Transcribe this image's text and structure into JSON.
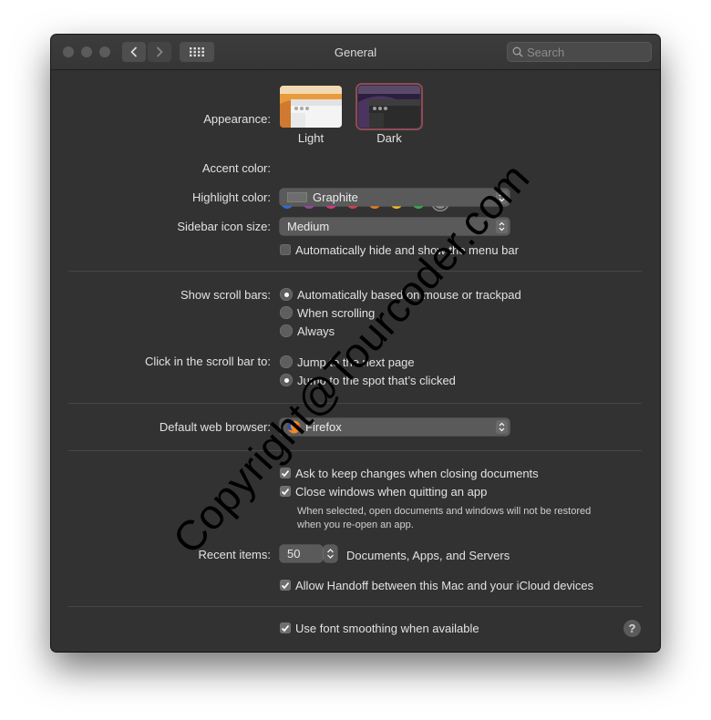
{
  "window": {
    "title": "General"
  },
  "search": {
    "placeholder": "Search"
  },
  "appearance": {
    "label": "Appearance:",
    "options": [
      "Light",
      "Dark"
    ],
    "selected": "Dark"
  },
  "accent": {
    "label": "Accent color:",
    "colors": [
      "#1e6cf0",
      "#a53bb3",
      "#ef2a84",
      "#e8334a",
      "#f07b18",
      "#f5bb1a",
      "#27b545",
      "#8c8c8c"
    ],
    "selected": "#8c8c8c"
  },
  "highlight": {
    "label": "Highlight color:",
    "value": "Graphite"
  },
  "sidebar_icon_size": {
    "label": "Sidebar icon size:",
    "value": "Medium"
  },
  "menu_bar": {
    "label": "Automatically hide and show the menu bar",
    "checked": false
  },
  "scroll_bars": {
    "label": "Show scroll bars:",
    "options": [
      "Automatically based on mouse or trackpad",
      "When scrolling",
      "Always"
    ],
    "selected": "Automatically based on mouse or trackpad"
  },
  "click_scroll": {
    "label": "Click in the scroll bar to:",
    "options": [
      "Jump to the next page",
      "Jump to the spot that’s clicked"
    ],
    "selected": "Jump to the spot that’s clicked"
  },
  "browser": {
    "label": "Default web browser:",
    "value": "Firefox"
  },
  "documents": {
    "ask_keep": {
      "label": "Ask to keep changes when closing documents",
      "checked": true
    },
    "close_windows": {
      "label": "Close windows when quitting an app",
      "checked": true
    },
    "note_line1": "When selected, open documents and windows will not be restored",
    "note_line2": "when you re-open an app."
  },
  "recent": {
    "label": "Recent items:",
    "value": "50",
    "suffix": "Documents, Apps, and Servers"
  },
  "handoff": {
    "label": "Allow Handoff between this Mac and your iCloud devices",
    "checked": true
  },
  "font_smoothing": {
    "label": "Use font smoothing when available",
    "checked": true
  },
  "help": {
    "label": "?"
  },
  "watermark": "Copyright@Tourcoder.com"
}
